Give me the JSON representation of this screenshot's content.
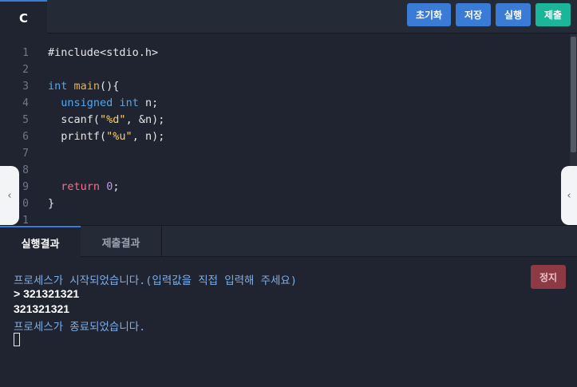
{
  "editor_tab": {
    "language": "C"
  },
  "toolbar": {
    "reset": {
      "label": "초기화",
      "color": "#3a7bd5"
    },
    "save": {
      "label": "저장",
      "color": "#3a7bd5"
    },
    "run": {
      "label": "실행",
      "color": "#3a7bd5"
    },
    "submit": {
      "label": "제출",
      "color": "#1bb59a"
    }
  },
  "code": {
    "line_numbers": [
      "1",
      "2",
      "3",
      "4",
      "5",
      "6",
      "7",
      "8",
      "9",
      "0",
      "1"
    ],
    "lines": [
      "#include<stdio.h>",
      "",
      "int main(){",
      "  unsigned int n;",
      "  scanf(\"%d\", &n);",
      "  printf(\"%u\", n);",
      "",
      "",
      "  return 0;",
      "}",
      ""
    ],
    "tokens": {
      "include": "#include<stdio.h>",
      "int": "int",
      "main": "main",
      "main_rest": "(){",
      "unsigned": "unsigned",
      "int2": "int",
      "n_decl": " n;",
      "scanf": "scanf(",
      "fmt_d": "\"%d\"",
      "scanf_rest": ", &n);",
      "printf": "printf(",
      "fmt_u": "\"%u\"",
      "printf_rest": ", n);",
      "return": "return",
      "zero": "0",
      "semi": ";",
      "brace": "}"
    }
  },
  "output_tabs": {
    "active": "실행결과",
    "inactive": "제출결과"
  },
  "console": {
    "start_message": "프로세스가 시작되었습니다.(입력값을 직접 입력해 주세요)",
    "input_line": "> 321321321",
    "output_line": "321321321",
    "end_message": "프로세스가 종료되었습니다.",
    "stop_button": "정지"
  },
  "colors": {
    "background": "#1f2430",
    "accent": "#3a7bd5",
    "submit": "#1bb59a",
    "stop": "#8d3a44"
  }
}
